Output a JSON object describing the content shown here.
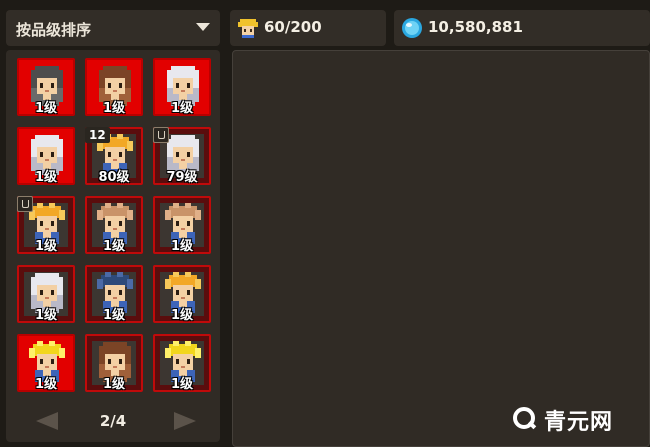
{
  "sort": {
    "label": "按品级排序"
  },
  "resources": {
    "hero_count": "60/200",
    "gems": "10,580,881"
  },
  "colors": {
    "slot_red": "#e20000",
    "slot_dark": "#5a0d0d",
    "panel": "#302b25"
  },
  "heroes": [
    {
      "level": "1级",
      "style": "red",
      "char": "gray-hood"
    },
    {
      "level": "1级",
      "style": "red",
      "char": "brown-hat"
    },
    {
      "level": "1级",
      "style": "red",
      "char": "white-hood"
    },
    {
      "level": "1级",
      "style": "red",
      "char": "white-hood"
    },
    {
      "level": "80级",
      "style": "dark",
      "char": "blonde",
      "badge": "12"
    },
    {
      "level": "79级",
      "style": "dark",
      "char": "white-hood",
      "badge_icon": "lock"
    },
    {
      "level": "1级",
      "style": "dark",
      "char": "blonde",
      "badge_icon": "lock"
    },
    {
      "level": "1级",
      "style": "dark",
      "char": "spiky-brown"
    },
    {
      "level": "1级",
      "style": "dark",
      "char": "spiky-brown"
    },
    {
      "level": "1级",
      "style": "dark",
      "char": "white-hood"
    },
    {
      "level": "1级",
      "style": "dark",
      "char": "blue-spiky"
    },
    {
      "level": "1级",
      "style": "dark",
      "char": "blonde"
    },
    {
      "level": "1级",
      "style": "red",
      "char": "yellow-hair"
    },
    {
      "level": "1级",
      "style": "dark",
      "char": "brown-hat"
    },
    {
      "level": "1级",
      "style": "dark",
      "char": "yellow-hair"
    }
  ],
  "pager": {
    "page": "2/4"
  },
  "watermark": {
    "text": "青元网"
  }
}
